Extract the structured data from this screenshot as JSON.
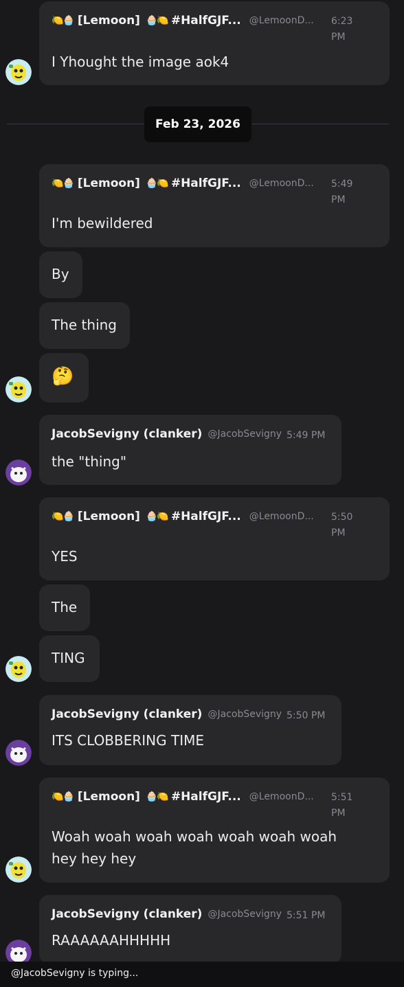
{
  "date_divider": "Feb 23, 2026",
  "typing_indicator": "@JacobSevigny is typing...",
  "colors": {
    "background": "#19191b",
    "bubble": "#28282b",
    "muted": "#8a8a8f",
    "date_pill": "#0c0c0d"
  },
  "users": {
    "lemoon": {
      "emoji_prefix": "🍋🧁",
      "name": "[Lemoon]",
      "emoji_mid": "🧁🍋",
      "name2": "#HalfGJF...",
      "handle": "@LemoonD...",
      "avatar_icon": "lemon-character-avatar"
    },
    "jacob": {
      "name": "JacobSevigny (clanker)",
      "handle": "@JacobSevigny",
      "avatar_icon": "purple-creature-avatar"
    }
  },
  "messages": [
    {
      "time_l1": "6:23",
      "time_l2": "PM",
      "text": "I Yhought the image aok4"
    },
    {
      "time_l1": "5:49",
      "time_l2": "PM",
      "text": "I'm bewildered"
    },
    {
      "text": "By"
    },
    {
      "text": "The thing"
    },
    {
      "text": "🤔"
    },
    {
      "time": "5:49 PM",
      "text": "the \"thing\""
    },
    {
      "time_l1": "5:50",
      "time_l2": "PM",
      "text": "YES"
    },
    {
      "text": "The"
    },
    {
      "text": "TING"
    },
    {
      "time": "5:50 PM",
      "text": "ITS CLOBBERING TIME"
    },
    {
      "time_l1": "5:51",
      "time_l2": "PM",
      "text_l1": "Woah woah woah woah woah woah woah",
      "text_l2": "hey hey hey"
    },
    {
      "time": "5:51 PM",
      "text": "RAAAAAAHHHHH"
    }
  ]
}
